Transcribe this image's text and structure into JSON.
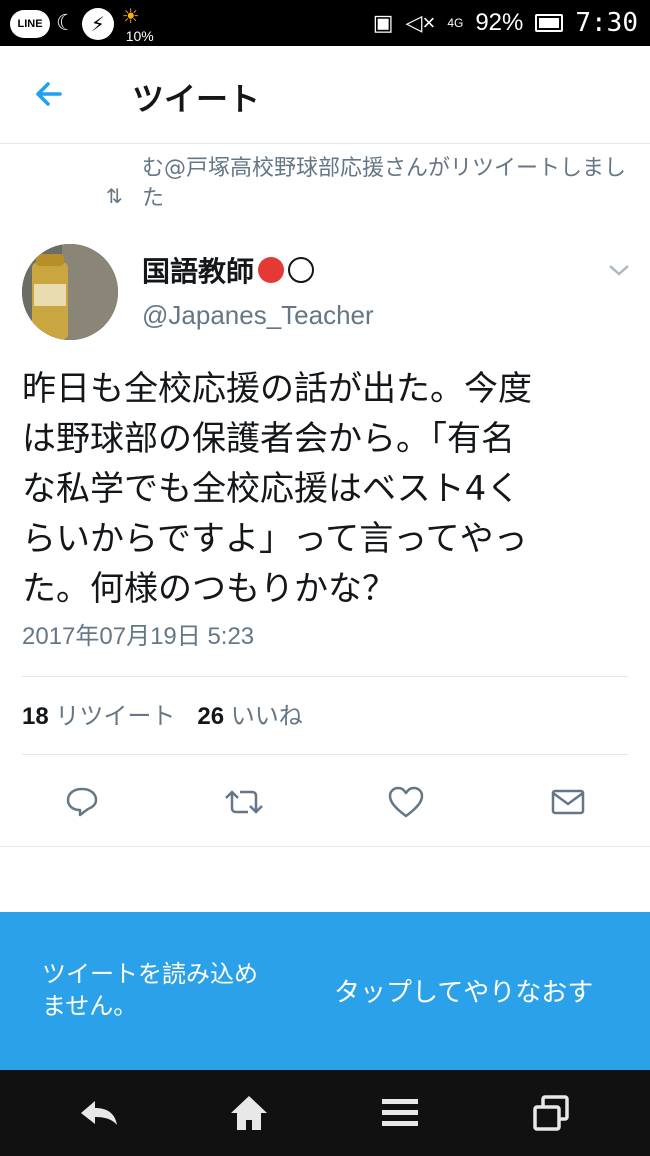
{
  "status_bar": {
    "line_label": "LINE",
    "weather_percent": "10%",
    "network": "4G",
    "battery": "92%",
    "time": "7:30"
  },
  "header": {
    "title": "ツイート"
  },
  "retweet_context": {
    "text": "む@戸塚高校野球部応援さんがリツイートしました"
  },
  "author": {
    "display_name": "国語教師",
    "handle": "@Japanes_Teacher"
  },
  "tweet": {
    "text": "昨日も全校応援の話が出た。今度\nは野球部の保護者会から。「有名\nな私学でも全校応援はベスト4く\nらいからですよ」って言ってやっ\nた。何様のつもりかな？",
    "timestamp": "2017年07月19日 5:23",
    "retweet_count": "18",
    "retweet_label": "リツイート",
    "like_count": "26",
    "like_label": "いいね"
  },
  "banner": {
    "message": "ツイートを読み込め\nません。",
    "retry": "タップしてやりなおす"
  },
  "colors": {
    "accent": "#1da1f2",
    "banner": "#2aa1e8",
    "muted": "#657786"
  }
}
